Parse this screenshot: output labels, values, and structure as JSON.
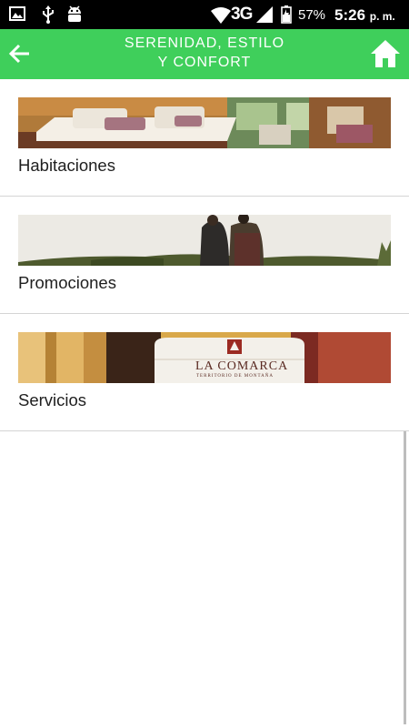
{
  "status_bar": {
    "network_type": "3G",
    "battery": "57%",
    "time": "5:26",
    "time_suffix": "p. m.",
    "notification_icons": [
      "image-icon",
      "usb-icon",
      "android-icon"
    ]
  },
  "app_bar": {
    "title_line1": "SERENIDAD, ESTILO",
    "title_line2": "Y CONFORT",
    "back_icon": "arrow-left-icon",
    "home_icon": "home-icon"
  },
  "menu": {
    "items": [
      {
        "label": "Habitaciones",
        "image": "hotel-room-photo"
      },
      {
        "label": "Promociones",
        "image": "couple-landscape-photo"
      },
      {
        "label": "Servicios",
        "image": "towel-logo-photo"
      }
    ],
    "towel_brand": "LA COMARCA",
    "towel_tagline": "TERRITORIO DE MONTAÑA"
  },
  "colors": {
    "accent": "#3fcf5b",
    "status_bar": "#000000",
    "divider": "#d4d4d4"
  }
}
